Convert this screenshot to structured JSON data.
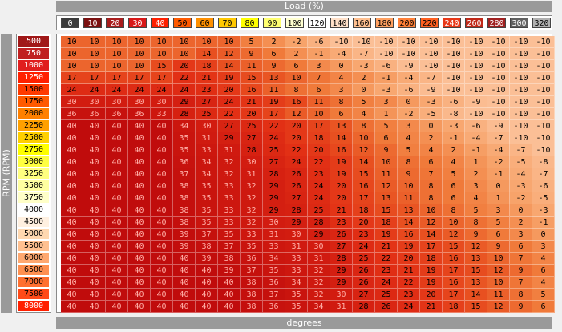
{
  "headers": {
    "load_title": "Load (%)",
    "rpm_title": "RPM (RPM)",
    "value_title": "degrees"
  },
  "load": [
    "0",
    "10",
    "20",
    "30",
    "40",
    "50",
    "60",
    "70",
    "80",
    "90",
    "100",
    "120",
    "140",
    "160",
    "180",
    "200",
    "220",
    "240",
    "260",
    "280",
    "300",
    "320"
  ],
  "load_colors": [
    "#3a3a3a",
    "#7a1010",
    "#a81c1c",
    "#d81818",
    "#ff2000",
    "#ff5a00",
    "#ff9000",
    "#ffc800",
    "#ffff00",
    "#ffff70",
    "#ffffd0",
    "#ffffff",
    "#ffe0c8",
    "#ffc090",
    "#ffa060",
    "#ff8038",
    "#ff6020",
    "#e83818",
    "#c02818",
    "#a02020",
    "#606060",
    "#b0b0b0"
  ],
  "rpm": [
    "500",
    "750",
    "1000",
    "1250",
    "1500",
    "1750",
    "2000",
    "2250",
    "2500",
    "2750",
    "3000",
    "3250",
    "3500",
    "3750",
    "4000",
    "4500",
    "5000",
    "5500",
    "6000",
    "6500",
    "7000",
    "7500",
    "8000"
  ],
  "rpm_colors": [
    "#a01818",
    "#c02020",
    "#e01e1e",
    "#ff2000",
    "#ff3a00",
    "#ff5a00",
    "#ff8000",
    "#ffa000",
    "#ffd000",
    "#ffff00",
    "#ffff40",
    "#ffff80",
    "#ffffa0",
    "#ffffc8",
    "#ffffff",
    "#fff0e0",
    "#ffd8b0",
    "#ffc090",
    "#ffa870",
    "#ff9050",
    "#ff7030",
    "#ff4a18",
    "#ff2000"
  ],
  "values": [
    [
      "10",
      "10",
      "10",
      "10",
      "10",
      "10",
      "10",
      "10",
      "5",
      "2",
      "-2",
      "-6",
      "-10",
      "-10",
      "-10",
      "-10",
      "-10",
      "-10",
      "-10",
      "-10",
      "-10",
      "-10"
    ],
    [
      "10",
      "10",
      "10",
      "10",
      "10",
      "10",
      "14",
      "12",
      "9",
      "6",
      "2",
      "-1",
      "-4",
      "-7",
      "-10",
      "-10",
      "-10",
      "-10",
      "-10",
      "-10",
      "-10",
      "-10"
    ],
    [
      "10",
      "10",
      "10",
      "10",
      "15",
      "20",
      "18",
      "14",
      "11",
      "9",
      "6",
      "3",
      "0",
      "-3",
      "-6",
      "-9",
      "-10",
      "-10",
      "-10",
      "-10",
      "-10",
      "-10"
    ],
    [
      "17",
      "17",
      "17",
      "17",
      "17",
      "22",
      "21",
      "19",
      "15",
      "13",
      "10",
      "7",
      "4",
      "2",
      "-1",
      "-4",
      "-7",
      "-10",
      "-10",
      "-10",
      "-10",
      "-10"
    ],
    [
      "24",
      "24",
      "24",
      "24",
      "24",
      "24",
      "23",
      "20",
      "16",
      "11",
      "8",
      "6",
      "3",
      "0",
      "-3",
      "-6",
      "-9",
      "-10",
      "-10",
      "-10",
      "-10",
      "-10"
    ],
    [
      "30",
      "30",
      "30",
      "30",
      "30",
      "29",
      "27",
      "24",
      "21",
      "19",
      "16",
      "11",
      "8",
      "5",
      "3",
      "0",
      "-3",
      "-6",
      "-9",
      "-10",
      "-10",
      "-10"
    ],
    [
      "36",
      "36",
      "36",
      "36",
      "33",
      "28",
      "25",
      "22",
      "20",
      "17",
      "12",
      "10",
      "6",
      "4",
      "1",
      "-2",
      "-5",
      "-8",
      "-10",
      "-10",
      "-10",
      "-10"
    ],
    [
      "40",
      "40",
      "40",
      "40",
      "40",
      "34",
      "30",
      "27",
      "25",
      "22",
      "20",
      "17",
      "13",
      "8",
      "5",
      "3",
      "0",
      "-3",
      "-6",
      "-9",
      "-10",
      "-10"
    ],
    [
      "40",
      "40",
      "40",
      "40",
      "40",
      "35",
      "31",
      "29",
      "27",
      "24",
      "20",
      "18",
      "14",
      "10",
      "6",
      "4",
      "2",
      "-1",
      "-4",
      "-7",
      "-10",
      "-10"
    ],
    [
      "40",
      "40",
      "40",
      "40",
      "40",
      "35",
      "33",
      "31",
      "28",
      "25",
      "22",
      "20",
      "16",
      "12",
      "9",
      "5",
      "4",
      "2",
      "-1",
      "-4",
      "-7",
      "-10"
    ],
    [
      "40",
      "40",
      "40",
      "40",
      "40",
      "36",
      "34",
      "32",
      "30",
      "27",
      "24",
      "22",
      "19",
      "14",
      "10",
      "8",
      "6",
      "4",
      "1",
      "-2",
      "-5",
      "-8"
    ],
    [
      "40",
      "40",
      "40",
      "40",
      "40",
      "37",
      "34",
      "32",
      "31",
      "28",
      "26",
      "23",
      "19",
      "15",
      "11",
      "9",
      "7",
      "5",
      "2",
      "-1",
      "-4",
      "-7"
    ],
    [
      "40",
      "40",
      "40",
      "40",
      "40",
      "38",
      "35",
      "33",
      "32",
      "29",
      "26",
      "24",
      "20",
      "16",
      "12",
      "10",
      "8",
      "6",
      "3",
      "0",
      "-3",
      "-6"
    ],
    [
      "40",
      "40",
      "40",
      "40",
      "40",
      "38",
      "35",
      "33",
      "32",
      "29",
      "27",
      "24",
      "20",
      "17",
      "13",
      "11",
      "8",
      "6",
      "4",
      "1",
      "-2",
      "-5"
    ],
    [
      "40",
      "40",
      "40",
      "40",
      "40",
      "38",
      "35",
      "33",
      "32",
      "29",
      "28",
      "25",
      "21",
      "18",
      "15",
      "13",
      "10",
      "8",
      "5",
      "3",
      "0",
      "-3"
    ],
    [
      "40",
      "40",
      "40",
      "40",
      "40",
      "38",
      "35",
      "33",
      "32",
      "30",
      "29",
      "28",
      "23",
      "20",
      "18",
      "14",
      "12",
      "10",
      "8",
      "5",
      "2",
      "-1"
    ],
    [
      "40",
      "40",
      "40",
      "40",
      "40",
      "39",
      "37",
      "35",
      "33",
      "31",
      "30",
      "29",
      "26",
      "23",
      "19",
      "16",
      "14",
      "12",
      "9",
      "6",
      "3",
      "0"
    ],
    [
      "40",
      "40",
      "40",
      "40",
      "40",
      "39",
      "38",
      "37",
      "35",
      "33",
      "31",
      "30",
      "27",
      "24",
      "21",
      "19",
      "17",
      "15",
      "12",
      "9",
      "6",
      "3"
    ],
    [
      "40",
      "40",
      "40",
      "40",
      "40",
      "40",
      "39",
      "38",
      "36",
      "34",
      "33",
      "31",
      "28",
      "25",
      "22",
      "20",
      "18",
      "16",
      "13",
      "10",
      "7",
      "4"
    ],
    [
      "40",
      "40",
      "40",
      "40",
      "40",
      "40",
      "40",
      "39",
      "37",
      "35",
      "33",
      "32",
      "29",
      "26",
      "23",
      "21",
      "19",
      "17",
      "15",
      "12",
      "9",
      "6"
    ],
    [
      "40",
      "40",
      "40",
      "40",
      "40",
      "40",
      "40",
      "40",
      "38",
      "36",
      "34",
      "32",
      "29",
      "26",
      "24",
      "22",
      "19",
      "16",
      "13",
      "10",
      "7",
      "4"
    ],
    [
      "40",
      "40",
      "40",
      "40",
      "40",
      "40",
      "40",
      "40",
      "38",
      "37",
      "35",
      "32",
      "30",
      "27",
      "25",
      "23",
      "20",
      "17",
      "14",
      "11",
      "8",
      "5"
    ],
    [
      "40",
      "40",
      "40",
      "40",
      "40",
      "40",
      "40",
      "40",
      "38",
      "36",
      "35",
      "34",
      "31",
      "28",
      "26",
      "24",
      "21",
      "18",
      "15",
      "12",
      "9",
      "6"
    ]
  ]
}
